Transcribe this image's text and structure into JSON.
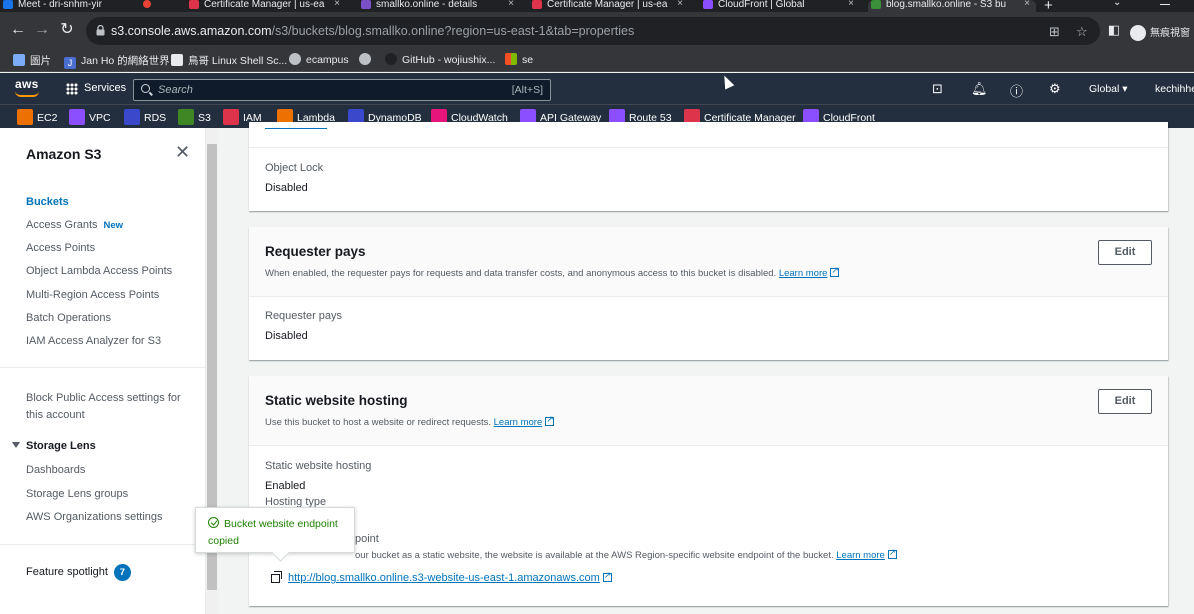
{
  "browser": {
    "tabs": [
      {
        "title": "Meet - dri-snhm-yir",
        "color": "#1a73e8"
      },
      {
        "title": "Certificate Manager | us-ea",
        "color": "#dd344c"
      },
      {
        "title": "smallko.online - details",
        "color": "#7b52c6"
      },
      {
        "title": "Certificate Manager | us-ea",
        "color": "#dd344c"
      },
      {
        "title": "CloudFront | Global",
        "color": "#8c4fff"
      },
      {
        "title": "blog.smallko.online - S3 bu",
        "color": "#3b8f3b"
      }
    ],
    "url_host": "s3.console.aws.amazon.com",
    "url_path": "/s3/buckets/blog.smallko.online?region=us-east-1&tab=properties",
    "profile_label": "無痕視窗",
    "bookmarks": [
      "圖片",
      "Jan Ho 的網絡世界",
      "鳥哥 Linux Shell Sc...",
      "ecampus",
      "GitHub - wojiushix...",
      "se"
    ]
  },
  "aws_header": {
    "logo": "aws",
    "services_label": "Services",
    "search_placeholder": "Search",
    "search_shortcut": "[Alt+S]",
    "region_label": "Global ▾",
    "account_label": "kechihhe"
  },
  "favorites": [
    {
      "label": "EC2",
      "color": "#ed7100"
    },
    {
      "label": "VPC",
      "color": "#8c4fff"
    },
    {
      "label": "RDS",
      "color": "#3b48cc"
    },
    {
      "label": "S3",
      "color": "#3f8624"
    },
    {
      "label": "IAM",
      "color": "#dd344c"
    },
    {
      "label": "Lambda",
      "color": "#ed7100"
    },
    {
      "label": "DynamoDB",
      "color": "#3b48cc"
    },
    {
      "label": "CloudWatch",
      "color": "#e7157b"
    },
    {
      "label": "API Gateway",
      "color": "#8c4fff"
    },
    {
      "label": "Route 53",
      "color": "#8c4fff"
    },
    {
      "label": "Certificate Manager",
      "color": "#dd344c"
    },
    {
      "label": "CloudFront",
      "color": "#8c4fff"
    }
  ],
  "sidebar": {
    "title": "Amazon S3",
    "items": [
      "Buckets",
      "Access Grants",
      "Access Points",
      "Object Lambda Access Points",
      "Multi-Region Access Points",
      "Batch Operations",
      "IAM Access Analyzer for S3"
    ],
    "new_badge": "New",
    "block_public_access_line1": "Block Public Access settings for",
    "block_public_access_line2": "this account",
    "storage_lens": {
      "label": "Storage Lens",
      "items": [
        "Dashboards",
        "Storage Lens groups",
        "AWS Organizations settings"
      ]
    },
    "feature_spotlight": "Feature spotlight",
    "feature_spotlight_count": "7"
  },
  "object_lock": {
    "label": "Object Lock",
    "value": "Disabled"
  },
  "requester_pays": {
    "title": "Requester pays",
    "description": "When enabled, the requester pays for requests and data transfer costs, and anonymous access to this bucket is disabled.",
    "learn_more": "Learn more",
    "edit_label": "Edit",
    "field_label": "Requester pays",
    "field_value": "Disabled"
  },
  "static_hosting": {
    "title": "Static website hosting",
    "description": "Use this bucket to host a website or redirect requests.",
    "learn_more": "Learn more",
    "edit_label": "Edit",
    "field_label": "Static website hosting",
    "field_value": "Enabled",
    "hosting_type_label": "Hosting type",
    "endpoint_label_visible": "point",
    "endpoint_desc_visible": "our bucket as a static website, the website is available at the AWS Region-specific website endpoint of the bucket.",
    "endpoint_learn_more": "Learn more",
    "endpoint_url": "http://blog.smallko.online.s3-website-us-east-1.amazonaws.com"
  },
  "toast": {
    "message": "Bucket website endpoint copied"
  }
}
